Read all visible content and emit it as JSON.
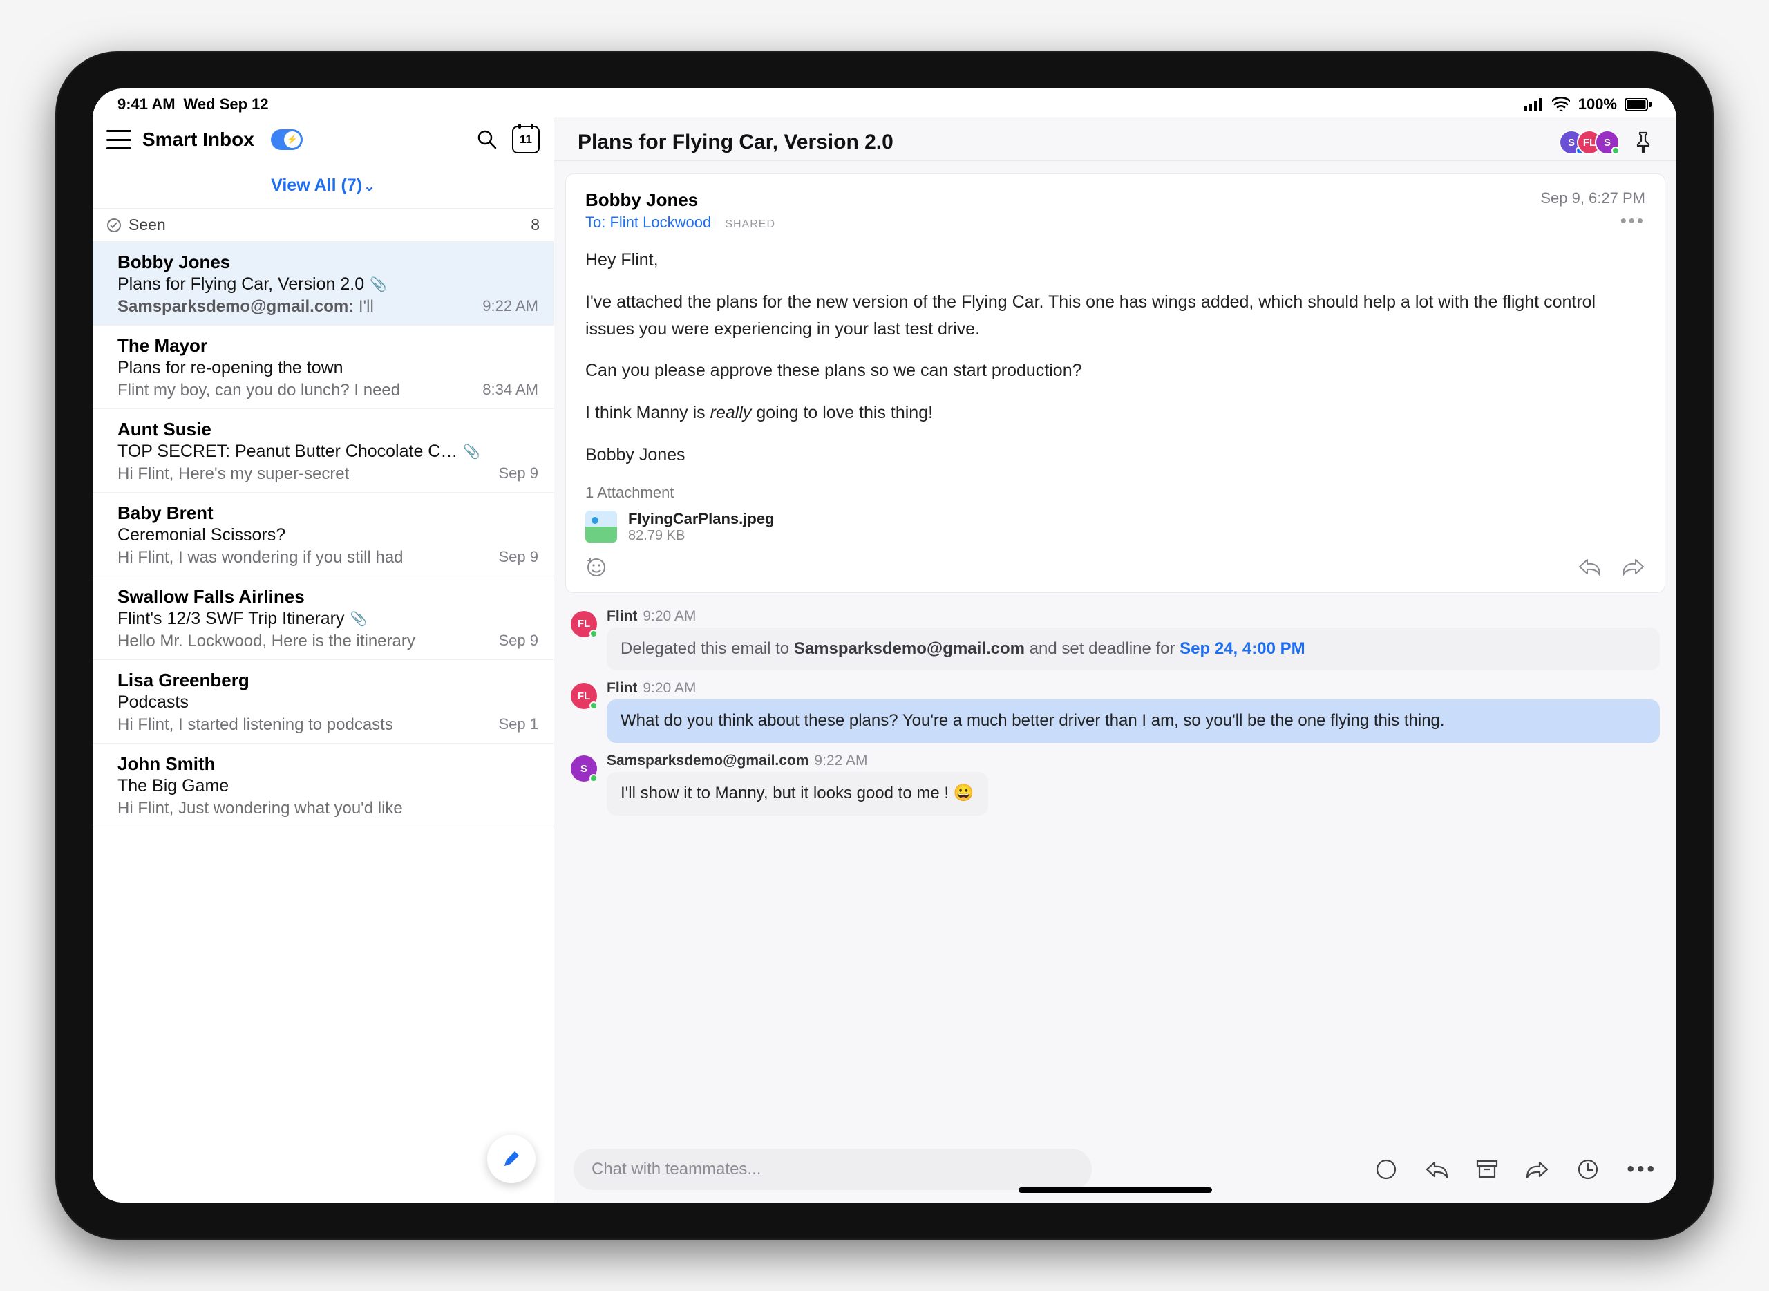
{
  "status": {
    "time": "9:41 AM",
    "date": "Wed Sep 12",
    "battery": "100%"
  },
  "sidebar": {
    "title": "Smart Inbox",
    "calendar_day": "11",
    "view_all": "View All (7)",
    "section_label": "Seen",
    "section_count": "8",
    "emails": [
      {
        "sender": "Bobby Jones",
        "subject": "Plans for Flying Car, Version 2.0",
        "has_attachment": true,
        "preview_strong": "Samsparksdemo@gmail.com:",
        "preview": " I'll",
        "time": "9:22 AM",
        "selected": true
      },
      {
        "sender": "The Mayor",
        "subject": "Plans for re-opening the town",
        "has_attachment": false,
        "preview_strong": "",
        "preview": "Flint my boy, can you do lunch? I need",
        "time": "8:34 AM",
        "selected": false
      },
      {
        "sender": "Aunt Susie",
        "subject": "TOP SECRET: Peanut Butter Chocolate C…",
        "has_attachment": true,
        "preview_strong": "",
        "preview": "Hi Flint, Here's my super-secret",
        "time": "Sep 9",
        "selected": false
      },
      {
        "sender": "Baby Brent",
        "subject": "Ceremonial Scissors?",
        "has_attachment": false,
        "preview_strong": "",
        "preview": "Hi Flint, I was wondering if you still had",
        "time": "Sep 9",
        "selected": false
      },
      {
        "sender": "Swallow Falls Airlines",
        "subject": "Flint's 12/3 SWF Trip Itinerary",
        "has_attachment": true,
        "preview_strong": "",
        "preview": "Hello Mr. Lockwood, Here is the itinerary",
        "time": "Sep 9",
        "selected": false
      },
      {
        "sender": "Lisa Greenberg",
        "subject": "Podcasts",
        "has_attachment": false,
        "preview_strong": "",
        "preview": "Hi Flint, I started listening to podcasts",
        "time": "Sep 1",
        "selected": false
      },
      {
        "sender": "John Smith",
        "subject": "The Big Game",
        "has_attachment": false,
        "preview_strong": "",
        "preview": "Hi Flint, Just wondering what you'd like",
        "time": "",
        "selected": false
      }
    ]
  },
  "thread": {
    "title": "Plans for Flying Car, Version 2.0",
    "message": {
      "from": "Bobby Jones",
      "to": "To: Flint Lockwood",
      "shared": "SHARED",
      "date": "Sep 9, 6:27 PM",
      "greeting": "Hey Flint,",
      "p1": "I've attached the plans for the new version of the Flying Car. This one has wings added, which should help a lot with the flight control issues you were experiencing in your last test drive.",
      "p2": "Can you please approve these plans so we can start production?",
      "p3a": "I think Manny is ",
      "p3i": "really",
      "p3b": " going to love this thing!",
      "signoff": "Bobby Jones",
      "attach_label": "1 Attachment",
      "attach_name": "FlyingCarPlans.jpeg",
      "attach_size": "82.79 KB"
    },
    "chats": [
      {
        "avatar": "FL",
        "avatar_color": "#e53963",
        "name": "Flint",
        "time": "9:20 AM",
        "style": "grey",
        "full_width": true,
        "text_pre": "Delegated this email to ",
        "text_strong": "Samsparksdemo@gmail.com",
        "text_mid": " and set deadline for ",
        "text_link": "Sep 24, 4:00 PM",
        "text_post": ""
      },
      {
        "avatar": "FL",
        "avatar_color": "#e53963",
        "name": "Flint",
        "time": "9:20 AM",
        "style": "blue",
        "full_width": true,
        "text_pre": "What do you think about these plans? You're a much better driver than I am, so you'll be the one flying this thing.",
        "text_strong": "",
        "text_mid": "",
        "text_link": "",
        "text_post": ""
      },
      {
        "avatar": "S",
        "avatar_color": "#9a2fc3",
        "name": "Samsparksdemo@gmail.com",
        "time": "9:22 AM",
        "style": "light",
        "full_width": false,
        "text_pre": "I'll show it to Manny, but it looks good to me ! 😀",
        "text_strong": "",
        "text_mid": "",
        "text_link": "",
        "text_post": ""
      }
    ],
    "chat_placeholder": "Chat with teammates..."
  }
}
